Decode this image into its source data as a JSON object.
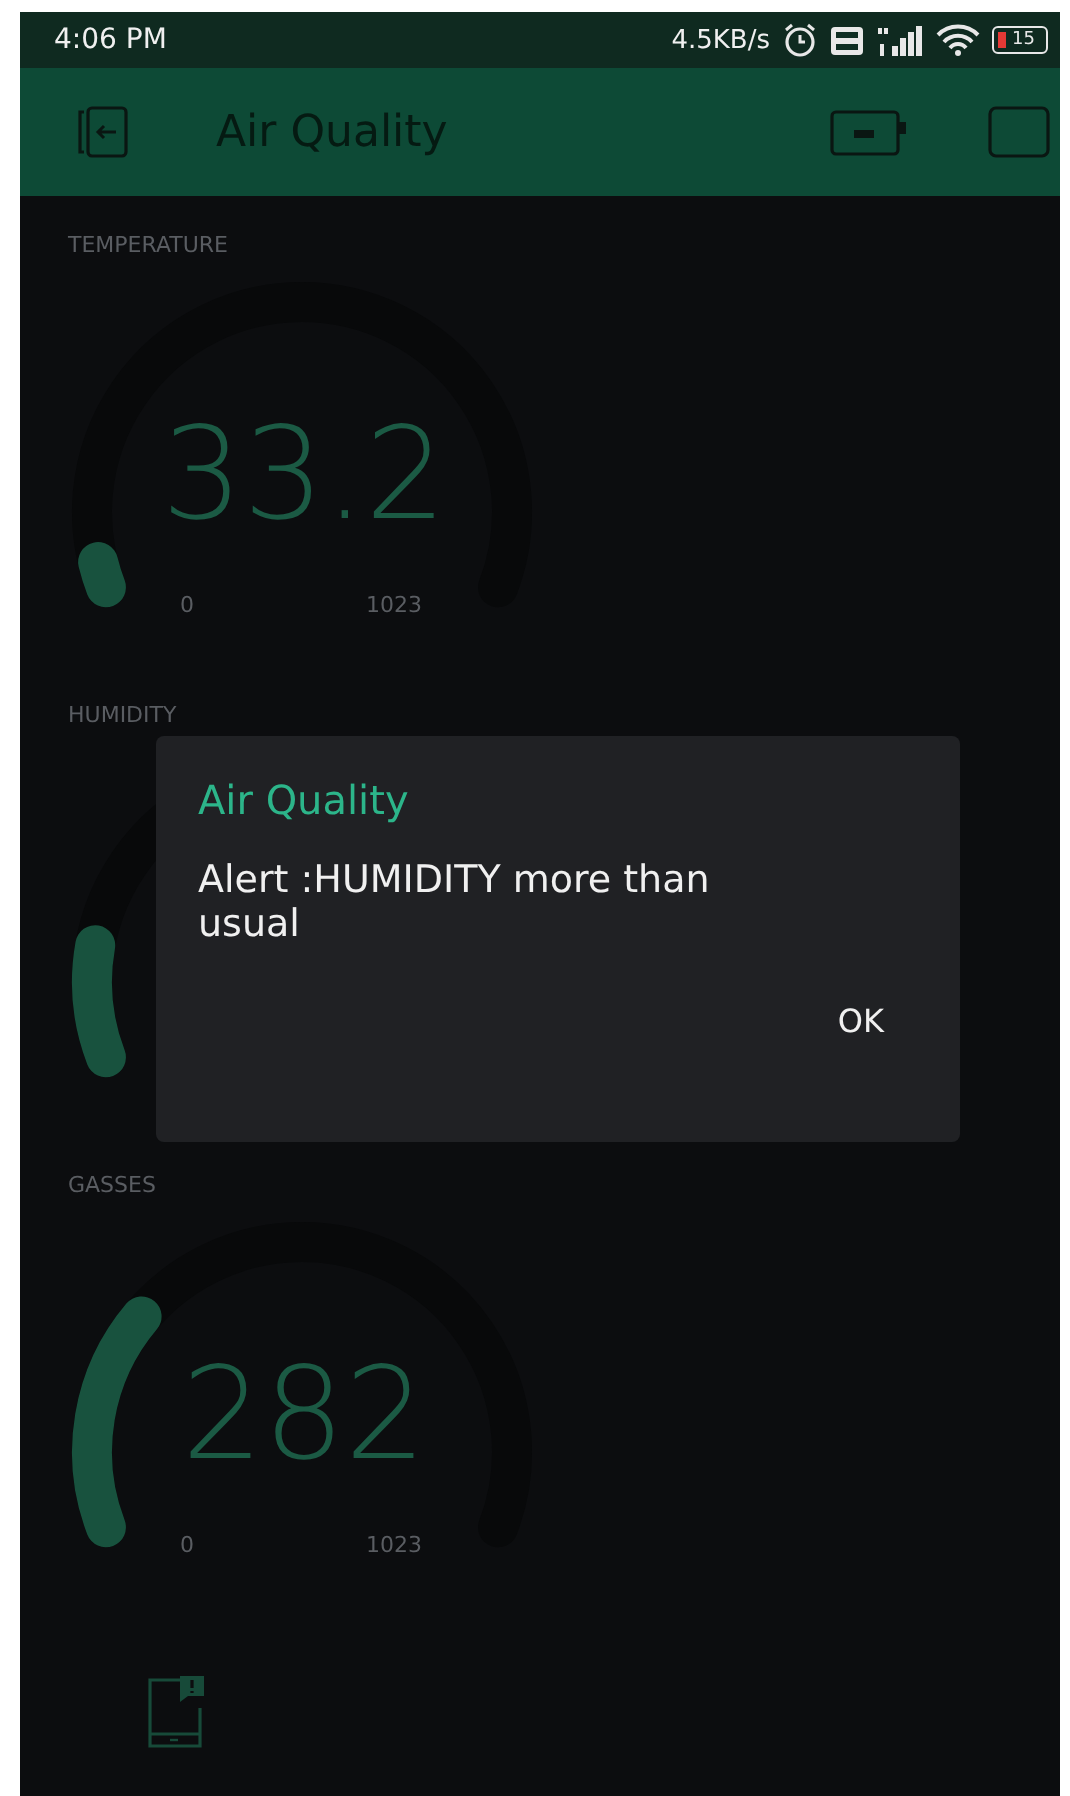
{
  "status_bar": {
    "time": "4:06 PM",
    "speed": "4.5KB/s",
    "battery": "15"
  },
  "header": {
    "title": "Air Quality"
  },
  "gauges": [
    {
      "label": "TEMPERATURE",
      "value": "33.2",
      "min": "0",
      "max": "1023"
    },
    {
      "label": "HUMIDITY"
    },
    {
      "label": "GASSES",
      "value": "282",
      "min": "0",
      "max": "1023"
    }
  ],
  "dialog": {
    "title": "Air Quality",
    "message": "Alert :HUMIDITY more than usual",
    "buttons": [
      "OK"
    ]
  }
}
